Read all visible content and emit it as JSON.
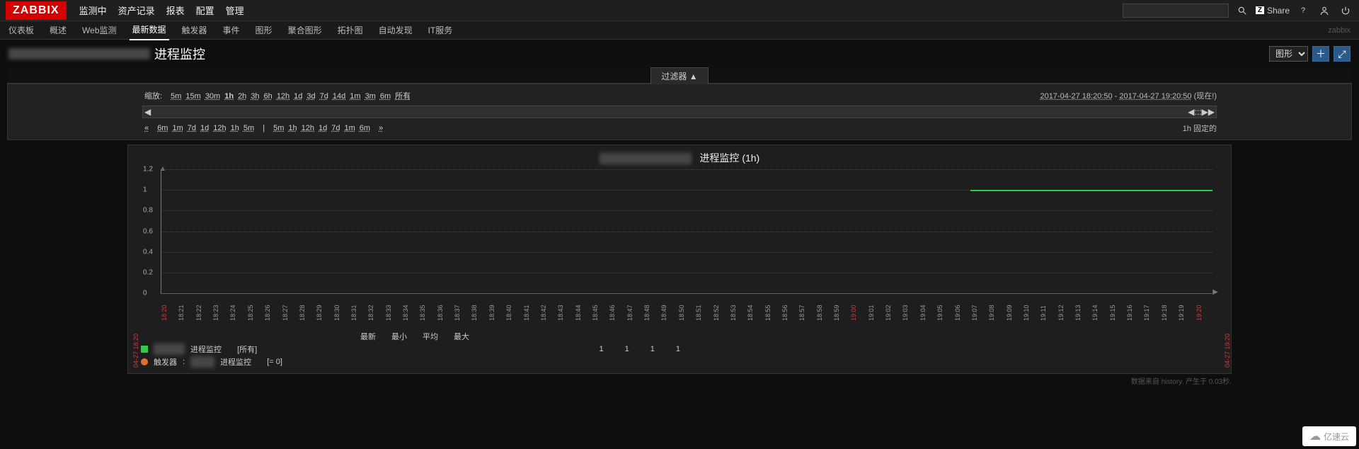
{
  "brand": "ZABBIX",
  "topmenu": [
    "监测中",
    "资产记录",
    "报表",
    "配置",
    "管理"
  ],
  "share_label": "Share",
  "subnav": [
    "仪表板",
    "概述",
    "Web监测",
    "最新数据",
    "触发器",
    "事件",
    "图形",
    "聚合图形",
    "拓扑图",
    "自动发现",
    "IT服务"
  ],
  "subnav_active_index": 3,
  "subnav_brand": "zabbix",
  "page_title": "进程监控",
  "view_select": "图形",
  "filter_tab": "过滤器 ▲",
  "zoom_label": "缩放:",
  "zoom_items": [
    "5m",
    "15m",
    "30m",
    "1h",
    "2h",
    "3h",
    "6h",
    "12h",
    "1d",
    "3d",
    "7d",
    "14d",
    "1m",
    "3m",
    "6m",
    "所有"
  ],
  "range_from": "2017-04-27 18:20:50",
  "range_to": "2017-04-27 19:20:50",
  "range_now": "(现在!)",
  "page_back_label": "«",
  "page_back": [
    "6m",
    "1m",
    "7d",
    "1d",
    "12h",
    "1h",
    "5m"
  ],
  "page_sep": "|",
  "page_fwd": [
    "5m",
    "1h",
    "12h",
    "1d",
    "7d",
    "1m",
    "6m"
  ],
  "page_fwd_label": "»",
  "fixed_label": "1h  固定的",
  "chart_title_suffix": "进程监控 (1h)",
  "legend_headers": [
    "最新",
    "最小",
    "平均",
    "最大"
  ],
  "legend_series": {
    "name_suffix": "进程监控",
    "agg": "[所有]",
    "vals": [
      "1",
      "1",
      "1",
      "1"
    ],
    "color": "#2ecc40"
  },
  "legend_trigger": {
    "label": "触发器",
    "name_suffix": "进程监控",
    "cond": "[= 0]",
    "color": "#e07030"
  },
  "footnote": "数据来自 history. 产生于 0.03秒.",
  "start_label": "04-27 18:20",
  "end_label": "04-27 19:20",
  "watermark": "亿速云",
  "chart_data": {
    "type": "line",
    "title": "进程监控 (1h)",
    "xlabel": "",
    "ylabel": "",
    "ylim": [
      0,
      1.2
    ],
    "yticks": [
      0,
      0.2,
      0.4,
      0.6,
      0.8,
      1.0,
      1.2
    ],
    "x_ticks": [
      "18:20",
      "18:21",
      "18:22",
      "18:23",
      "18:24",
      "18:25",
      "18:26",
      "18:27",
      "18:28",
      "18:29",
      "18:30",
      "18:31",
      "18:32",
      "18:33",
      "18:34",
      "18:35",
      "18:36",
      "18:37",
      "18:38",
      "18:39",
      "18:40",
      "18:41",
      "18:42",
      "18:43",
      "18:44",
      "18:45",
      "18:46",
      "18:47",
      "18:48",
      "18:49",
      "18:50",
      "18:51",
      "18:52",
      "18:53",
      "18:54",
      "18:55",
      "18:56",
      "18:57",
      "18:58",
      "18:59",
      "19:00",
      "19:01",
      "19:02",
      "19:03",
      "19:04",
      "19:05",
      "19:06",
      "19:07",
      "19:08",
      "19:09",
      "19:10",
      "19:11",
      "19:12",
      "19:13",
      "19:14",
      "19:15",
      "19:16",
      "19:17",
      "19:18",
      "19:19",
      "19:20"
    ],
    "x_red_indices": [
      0,
      40,
      60
    ],
    "series": [
      {
        "name": "进程监控",
        "color": "#2ecc40",
        "segments": [
          {
            "x_start_frac": 0.77,
            "x_end_frac": 1.0,
            "y": 1
          }
        ]
      }
    ]
  }
}
